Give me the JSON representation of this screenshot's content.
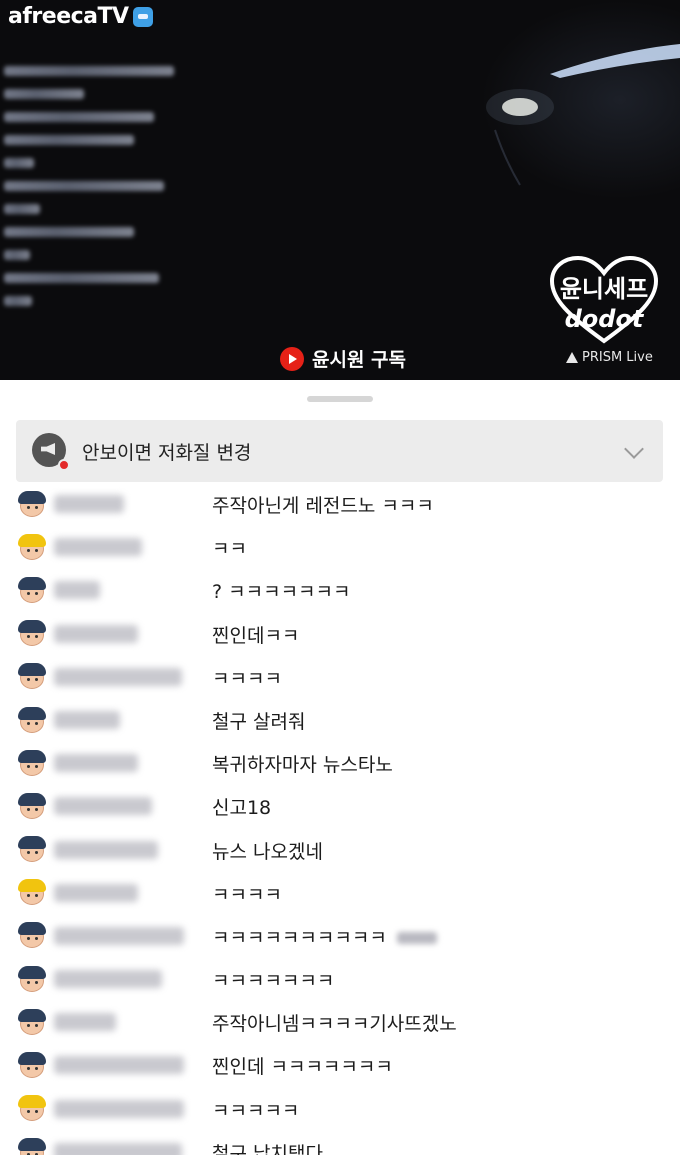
{
  "player": {
    "brand_logo": "afreecaTV",
    "subscribe_text": "윤시원 구독",
    "watermark_name": "윤니세프",
    "watermark_sub": "dodot",
    "broadcast_tag": "PRISM Live"
  },
  "notice": {
    "text": "안보이면 저화질 변경"
  },
  "chat": {
    "messages": [
      {
        "avatar": "boy",
        "text": "주작아닌게 레전드노 ㅋㅋㅋ"
      },
      {
        "avatar": "gold",
        "text": "ㅋㅋ"
      },
      {
        "avatar": "boy",
        "text": "? ㅋㅋㅋㅋㅋㅋㅋ"
      },
      {
        "avatar": "boy",
        "text": "찐인데ㅋㅋ"
      },
      {
        "avatar": "boy",
        "text": "ㅋㅋㅋㅋ"
      },
      {
        "avatar": "boy",
        "text": "철구 살려줘"
      },
      {
        "avatar": "boy",
        "text": "복귀하자마자 뉴스타노"
      },
      {
        "avatar": "boy",
        "text": "신고18"
      },
      {
        "avatar": "boy",
        "text": "뉴스 나오겠네"
      },
      {
        "avatar": "gold",
        "text": "ㅋㅋㅋㅋ"
      },
      {
        "avatar": "boy",
        "text": "ㅋㅋㅋㅋㅋㅋㅋㅋㅋㅋ"
      },
      {
        "avatar": "boy",
        "text": "ㅋㅋㅋㅋㅋㅋㅋ"
      },
      {
        "avatar": "boy",
        "text": "주작아니넴ㅋㅋㅋㅋ기사뜨겠노"
      },
      {
        "avatar": "boy",
        "text": "찐인데 ㅋㅋㅋㅋㅋㅋㅋ"
      },
      {
        "avatar": "gold",
        "text": "ㅋㅋㅋㅋㅋ"
      },
      {
        "avatar": "boy",
        "text": "철구 납치탰다"
      }
    ]
  }
}
